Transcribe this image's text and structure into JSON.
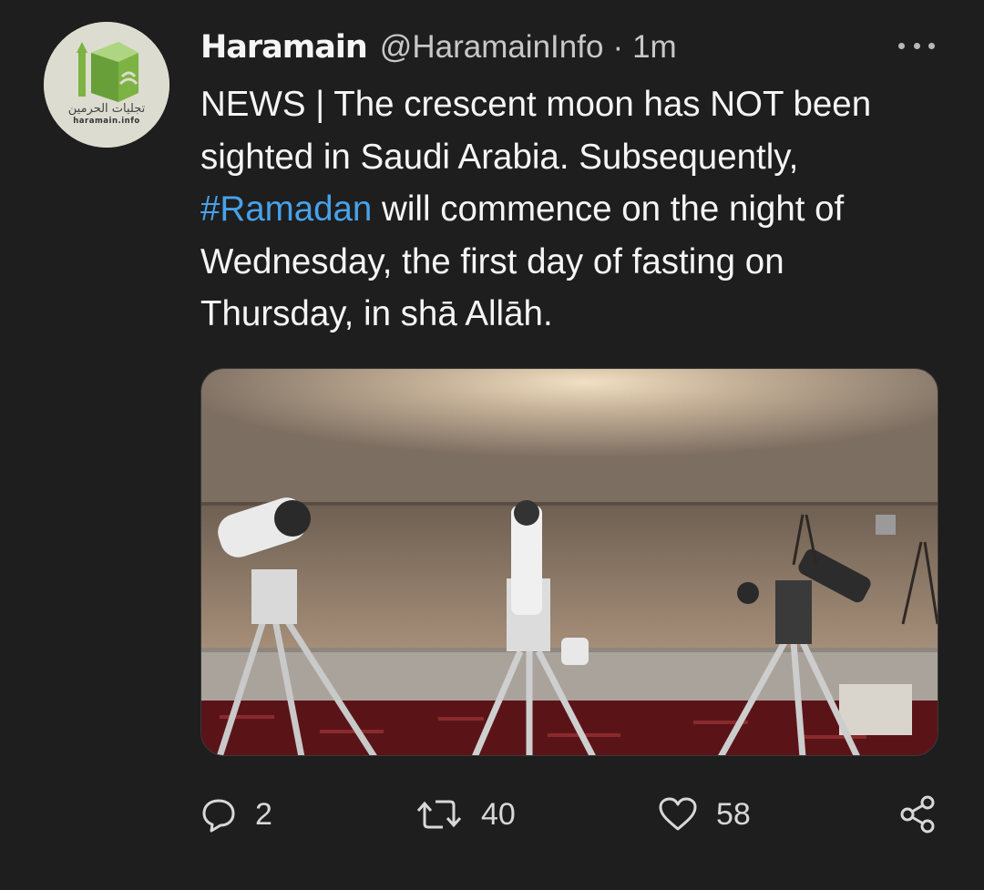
{
  "author": {
    "display_name": "Haramain",
    "handle": "@HaramainInfo",
    "separator": "·",
    "time": "1m",
    "avatar_arabic": "تجليات الحرمين",
    "avatar_caption": "haramain.info"
  },
  "tweet": {
    "text_lines": [
      "NEWS | The crescent moon has NOT been",
      "sighted in Saudi Arabia. Subsequently,",
      " will commence on the night of",
      "Wednesday, the first day of fasting on",
      "Thursday, in shā Allāh."
    ],
    "hashtag": "#Ramadan"
  },
  "media": {
    "description_icon": "photo-telescopes-desert"
  },
  "actions": {
    "reply_count": "2",
    "retweet_count": "40",
    "like_count": "58"
  },
  "icons": {
    "reply": "reply-icon",
    "retweet": "retweet-icon",
    "like": "heart-icon",
    "share": "share-icon",
    "more": "more-icon"
  },
  "colors": {
    "background": "#1e1e1e",
    "text": "#f5f5f5",
    "secondary": "#c8c8c8",
    "link": "#47a2ea",
    "avatar_green": "#7cb342"
  }
}
